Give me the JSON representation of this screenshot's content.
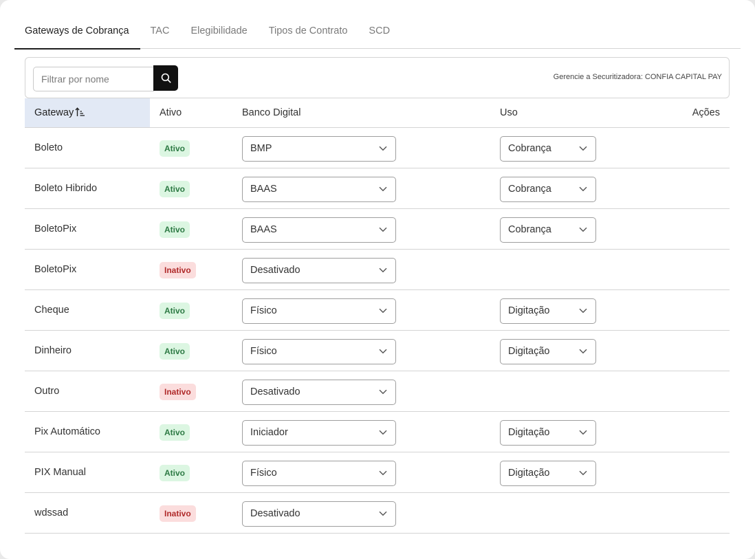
{
  "tabs": [
    {
      "label": "Gateways de Cobrança",
      "active": true
    },
    {
      "label": "TAC",
      "active": false
    },
    {
      "label": "Elegibilidade",
      "active": false
    },
    {
      "label": "Tipos de Contrato",
      "active": false
    },
    {
      "label": "SCD",
      "active": false
    }
  ],
  "filter": {
    "placeholder": "Filtrar por nome",
    "button_icon": "search-icon",
    "manage_label": "Gerencie a Securitizadora: CONFIA CAPITAL PAY"
  },
  "table": {
    "headers": {
      "gateway": "Gateway",
      "ativo": "Ativo",
      "banco": "Banco Digital",
      "uso": "Uso",
      "acoes": "Ações"
    },
    "sort_icon": "sort-ascending-icon",
    "rows": [
      {
        "name": "Boleto",
        "status": "Ativo",
        "active": true,
        "banco": "BMP",
        "uso": "Cobrança"
      },
      {
        "name": "Boleto Hibrido",
        "status": "Ativo",
        "active": true,
        "banco": "BAAS",
        "uso": "Cobrança"
      },
      {
        "name": "BoletoPix",
        "status": "Ativo",
        "active": true,
        "banco": "BAAS",
        "uso": "Cobrança"
      },
      {
        "name": "BoletoPix",
        "status": "Inativo",
        "active": false,
        "banco": "Desativado",
        "uso": null
      },
      {
        "name": "Cheque",
        "status": "Ativo",
        "active": true,
        "banco": "Físico",
        "uso": "Digitação"
      },
      {
        "name": "Dinheiro",
        "status": "Ativo",
        "active": true,
        "banco": "Físico",
        "uso": "Digitação"
      },
      {
        "name": "Outro",
        "status": "Inativo",
        "active": false,
        "banco": "Desativado",
        "uso": null
      },
      {
        "name": "Pix Automático",
        "status": "Ativo",
        "active": true,
        "banco": "Iniciador",
        "uso": "Digitação"
      },
      {
        "name": "PIX Manual",
        "status": "Ativo",
        "active": true,
        "banco": "Físico",
        "uso": "Digitação"
      },
      {
        "name": "wdssad",
        "status": "Inativo",
        "active": false,
        "banco": "Desativado",
        "uso": null
      }
    ]
  },
  "colors": {
    "active_badge_bg": "#dcf6e2",
    "active_badge_text": "#2d7a44",
    "inactive_badge_bg": "#fbdddd",
    "inactive_badge_text": "#b02a2a",
    "sorted_header_bg": "#e2e9f5",
    "search_button_bg": "#111111"
  }
}
